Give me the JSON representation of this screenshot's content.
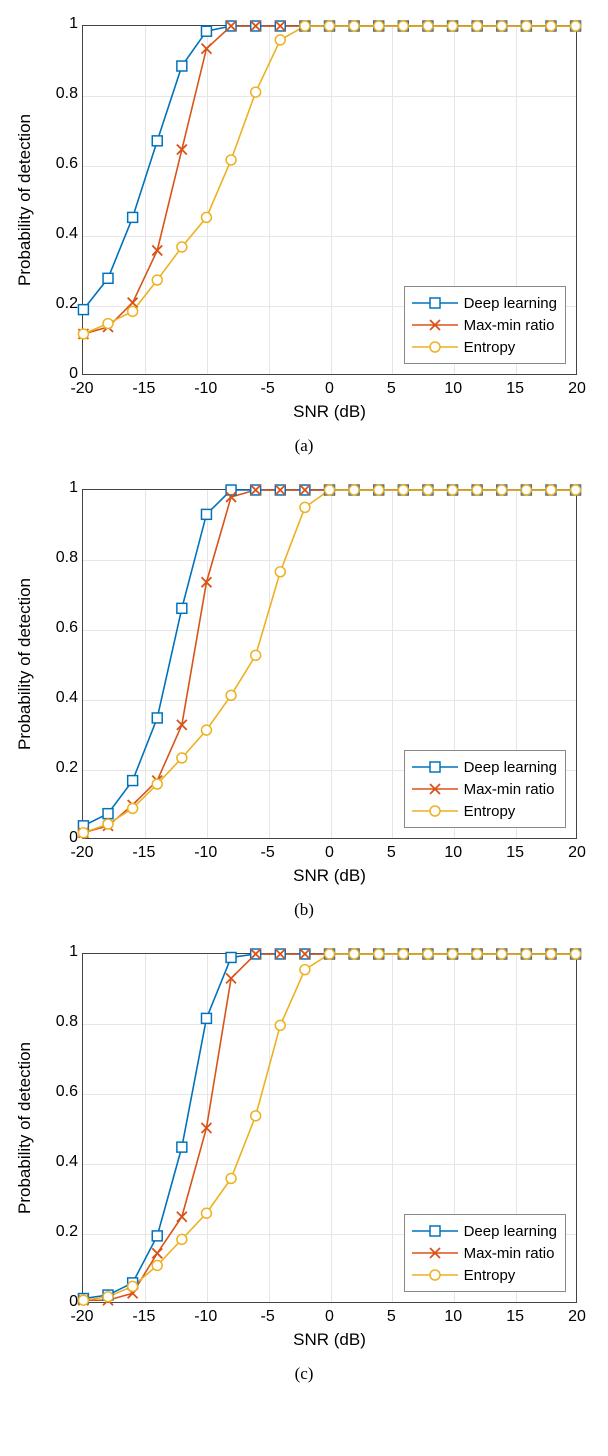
{
  "chart_data": [
    {
      "type": "line",
      "sublabel": "(a)",
      "xlabel": "SNR (dB)",
      "ylabel": "Probability of detection",
      "xlim": [
        -20,
        20
      ],
      "ylim": [
        0,
        1
      ],
      "xticks": [
        -20,
        -15,
        -10,
        -5,
        0,
        5,
        10,
        15,
        20
      ],
      "yticks": [
        0,
        0.2,
        0.4,
        0.6,
        0.8,
        1
      ],
      "legend_position": "bottom-right",
      "x": [
        -20,
        -18,
        -16,
        -14,
        -12,
        -10,
        -8,
        -6,
        -4,
        -2,
        0,
        2,
        4,
        6,
        8,
        10,
        12,
        14,
        16,
        18,
        20
      ],
      "series": [
        {
          "name": "Deep learning",
          "color": "#0072BD",
          "marker": "square",
          "values": [
            0.185,
            0.275,
            0.45,
            0.67,
            0.885,
            0.985,
            1.0,
            1.0,
            1.0,
            1.0,
            1.0,
            1.0,
            1.0,
            1.0,
            1.0,
            1.0,
            1.0,
            1.0,
            1.0,
            1.0,
            1.0
          ]
        },
        {
          "name": "Max-min ratio",
          "color": "#D95319",
          "marker": "x",
          "values": [
            0.115,
            0.135,
            0.205,
            0.355,
            0.645,
            0.935,
            1.0,
            1.0,
            1.0,
            1.0,
            1.0,
            1.0,
            1.0,
            1.0,
            1.0,
            1.0,
            1.0,
            1.0,
            1.0,
            1.0,
            1.0
          ]
        },
        {
          "name": "Entropy",
          "color": "#EDB120",
          "marker": "circle",
          "values": [
            0.115,
            0.145,
            0.18,
            0.27,
            0.365,
            0.45,
            0.615,
            0.81,
            0.96,
            1.0,
            1.0,
            1.0,
            1.0,
            1.0,
            1.0,
            1.0,
            1.0,
            1.0,
            1.0,
            1.0,
            1.0
          ]
        }
      ]
    },
    {
      "type": "line",
      "sublabel": "(b)",
      "xlabel": "SNR (dB)",
      "ylabel": "Probability of detection",
      "xlim": [
        -20,
        20
      ],
      "ylim": [
        0,
        1
      ],
      "xticks": [
        -20,
        -15,
        -10,
        -5,
        0,
        5,
        10,
        15,
        20
      ],
      "yticks": [
        0,
        0.2,
        0.4,
        0.6,
        0.8,
        1
      ],
      "legend_position": "bottom-right",
      "x": [
        -20,
        -18,
        -16,
        -14,
        -12,
        -10,
        -8,
        -6,
        -4,
        -2,
        0,
        2,
        4,
        6,
        8,
        10,
        12,
        14,
        16,
        18,
        20
      ],
      "series": [
        {
          "name": "Deep learning",
          "color": "#0072BD",
          "marker": "square",
          "values": [
            0.035,
            0.07,
            0.165,
            0.345,
            0.66,
            0.93,
            1.0,
            1.0,
            1.0,
            1.0,
            1.0,
            1.0,
            1.0,
            1.0,
            1.0,
            1.0,
            1.0,
            1.0,
            1.0,
            1.0,
            1.0
          ]
        },
        {
          "name": "Max-min ratio",
          "color": "#D95319",
          "marker": "x",
          "values": [
            0.015,
            0.035,
            0.095,
            0.165,
            0.325,
            0.735,
            0.98,
            1.0,
            1.0,
            1.0,
            1.0,
            1.0,
            1.0,
            1.0,
            1.0,
            1.0,
            1.0,
            1.0,
            1.0,
            1.0,
            1.0
          ]
        },
        {
          "name": "Entropy",
          "color": "#EDB120",
          "marker": "circle",
          "values": [
            0.015,
            0.04,
            0.085,
            0.155,
            0.23,
            0.31,
            0.41,
            0.525,
            0.765,
            0.95,
            1.0,
            1.0,
            1.0,
            1.0,
            1.0,
            1.0,
            1.0,
            1.0,
            1.0,
            1.0,
            1.0
          ]
        }
      ]
    },
    {
      "type": "line",
      "sublabel": "(c)",
      "xlabel": "SNR (dB)",
      "ylabel": "Probability of detection",
      "xlim": [
        -20,
        20
      ],
      "ylim": [
        0,
        1
      ],
      "xticks": [
        -20,
        -15,
        -10,
        -5,
        0,
        5,
        10,
        15,
        20
      ],
      "yticks": [
        0,
        0.2,
        0.4,
        0.6,
        0.8,
        1
      ],
      "legend_position": "bottom-right",
      "x": [
        -20,
        -18,
        -16,
        -14,
        -12,
        -10,
        -8,
        -6,
        -4,
        -2,
        0,
        2,
        4,
        6,
        8,
        10,
        12,
        14,
        16,
        18,
        20
      ],
      "series": [
        {
          "name": "Deep learning",
          "color": "#0072BD",
          "marker": "square",
          "values": [
            0.01,
            0.02,
            0.055,
            0.19,
            0.445,
            0.815,
            0.99,
            1.0,
            1.0,
            1.0,
            1.0,
            1.0,
            1.0,
            1.0,
            1.0,
            1.0,
            1.0,
            1.0,
            1.0,
            1.0,
            1.0
          ]
        },
        {
          "name": "Max-min ratio",
          "color": "#D95319",
          "marker": "x",
          "values": [
            0.005,
            0.005,
            0.025,
            0.14,
            0.245,
            0.5,
            0.93,
            1.0,
            1.0,
            1.0,
            1.0,
            1.0,
            1.0,
            1.0,
            1.0,
            1.0,
            1.0,
            1.0,
            1.0,
            1.0,
            1.0
          ]
        },
        {
          "name": "Entropy",
          "color": "#EDB120",
          "marker": "circle",
          "values": [
            0.005,
            0.015,
            0.045,
            0.105,
            0.18,
            0.255,
            0.355,
            0.535,
            0.795,
            0.955,
            1.0,
            1.0,
            1.0,
            1.0,
            1.0,
            1.0,
            1.0,
            1.0,
            1.0,
            1.0,
            1.0
          ]
        }
      ]
    }
  ]
}
